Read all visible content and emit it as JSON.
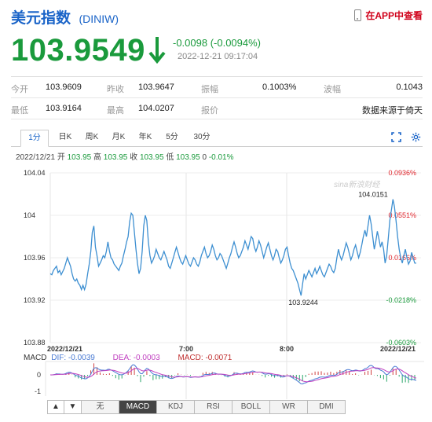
{
  "header": {
    "name": "美元指数",
    "code": "(DINIW)",
    "app_link": "在APP中查看"
  },
  "quote": {
    "price": "103.9549",
    "change": "-0.0098 (-0.0094%)",
    "timestamp": "2022-12-21 09:17:04"
  },
  "stats": {
    "row1": [
      {
        "label": "今开",
        "value": "103.9609"
      },
      {
        "label": "昨收",
        "value": "103.9647"
      },
      {
        "label": "振幅",
        "value": "0.1003%"
      },
      {
        "label": "波幅",
        "value": "0.1043"
      }
    ],
    "row2": [
      {
        "label": "最低",
        "value": "103.9164"
      },
      {
        "label": "最高",
        "value": "104.0207"
      },
      {
        "label": "报价",
        "value": "数据来源于倚天"
      }
    ]
  },
  "tabs": [
    "1分",
    "日K",
    "周K",
    "月K",
    "年K",
    "5分",
    "30分"
  ],
  "info": {
    "date": "2022/12/21",
    "open_label": "开",
    "open": "103.95",
    "high_label": "高",
    "high": "103.95",
    "close_label": "收",
    "close": "103.95",
    "low_label": "低",
    "low": "103.95",
    "vol": "0",
    "pct": "-0.01%"
  },
  "chart_data": {
    "type": "line",
    "y_ticks": [
      "104.04",
      "104",
      "103.96",
      "103.92",
      "103.88"
    ],
    "ylim": [
      103.88,
      104.04
    ],
    "pct_ticks": [
      {
        "label": "0.0936%",
        "color": "#e0262d"
      },
      {
        "label": "0.0551%",
        "color": "#e0262d"
      },
      {
        "label": "0.0166%",
        "color": "#e0262d"
      },
      {
        "label": "-0.0218%",
        "color": "#1a9a3c"
      },
      {
        "label": "-0.0603%",
        "color": "#1a9a3c"
      }
    ],
    "x_labels": [
      "2022/12/21",
      "7:00",
      "8:00",
      "2022/12/21"
    ],
    "annotations": {
      "high": "104.0151",
      "low": "103.9244"
    },
    "watermark": "sina新浪财经",
    "series": [
      {
        "values": [
          103.945,
          103.944,
          103.948,
          103.95,
          103.952,
          103.946,
          103.948,
          103.944,
          103.947,
          103.95,
          103.955,
          103.96,
          103.956,
          103.952,
          103.945,
          103.94,
          103.938,
          103.94,
          103.936,
          103.934,
          103.93,
          103.934,
          103.93,
          103.935,
          103.945,
          103.954,
          103.966,
          103.984,
          103.99,
          103.97,
          103.962,
          103.952,
          103.955,
          103.958,
          103.962,
          103.96,
          103.966,
          103.975,
          103.966,
          103.96,
          103.958,
          103.954,
          103.952,
          103.95,
          103.948,
          103.952,
          103.955,
          103.962,
          103.968,
          103.975,
          103.98,
          103.994,
          104.002,
          104.0,
          103.984,
          103.968,
          103.955,
          103.945,
          103.95,
          103.966,
          103.99,
          104.0,
          103.995,
          103.975,
          103.962,
          103.955,
          103.958,
          103.962,
          103.968,
          103.964,
          103.96,
          103.958,
          103.962,
          103.966,
          103.962,
          103.958,
          103.952,
          103.95,
          103.955,
          103.96,
          103.965,
          103.97,
          103.965,
          103.96,
          103.956,
          103.954,
          103.958,
          103.962,
          103.958,
          103.954,
          103.952,
          103.956,
          103.96,
          103.958,
          103.954,
          103.952,
          103.956,
          103.962,
          103.966,
          103.97,
          103.964,
          103.96,
          103.962,
          103.966,
          103.972,
          103.968,
          103.962,
          103.958,
          103.96,
          103.964,
          103.962,
          103.958,
          103.954,
          103.95,
          103.955,
          103.96,
          103.964,
          103.97,
          103.975,
          103.97,
          103.964,
          103.96,
          103.962,
          103.966,
          103.97,
          103.976,
          103.972,
          103.968,
          103.974,
          103.98,
          103.978,
          103.97,
          103.966,
          103.97,
          103.976,
          103.972,
          103.966,
          103.96,
          103.965,
          103.97,
          103.974,
          103.968,
          103.962,
          103.958,
          103.962,
          103.968,
          103.966,
          103.96,
          103.955,
          103.958,
          103.962,
          103.968,
          103.97,
          103.962,
          103.955,
          103.95,
          103.948,
          103.944,
          103.94,
          103.936,
          103.93,
          103.9244,
          103.935,
          103.945,
          103.94,
          103.944,
          103.948,
          103.945,
          103.942,
          103.946,
          103.95,
          103.945,
          103.948,
          103.952,
          103.948,
          103.944,
          103.942,
          103.946,
          103.95,
          103.954,
          103.952,
          103.948,
          103.946,
          103.95,
          103.96,
          103.968,
          103.962,
          103.958,
          103.962,
          103.968,
          103.974,
          103.97,
          103.964,
          103.958,
          103.962,
          103.968,
          103.972,
          103.966,
          103.96,
          103.965,
          103.972,
          103.98,
          103.986,
          103.98,
          103.99,
          104.0,
          103.992,
          103.98,
          103.968,
          103.975,
          103.985,
          103.978,
          103.97,
          103.975,
          103.968,
          103.955,
          103.962,
          103.978,
          103.995,
          104.005,
          104.0151,
          104.008,
          103.995,
          103.98,
          103.968,
          103.96,
          103.955,
          103.962,
          103.968,
          103.96,
          103.954,
          103.957,
          103.965,
          103.96,
          103.955,
          103.9549
        ]
      }
    ]
  },
  "macd": {
    "label": "MACD",
    "dif": "DIF: -0.0039",
    "dea": "DEA: -0.0003",
    "macd": "MACD: -0.0071",
    "ticks": [
      "0",
      "-1"
    ]
  },
  "bottom_tabs": [
    "▲",
    "▼",
    "无",
    "MACD",
    "KDJ",
    "RSI",
    "BOLL",
    "WR",
    "DMI"
  ]
}
